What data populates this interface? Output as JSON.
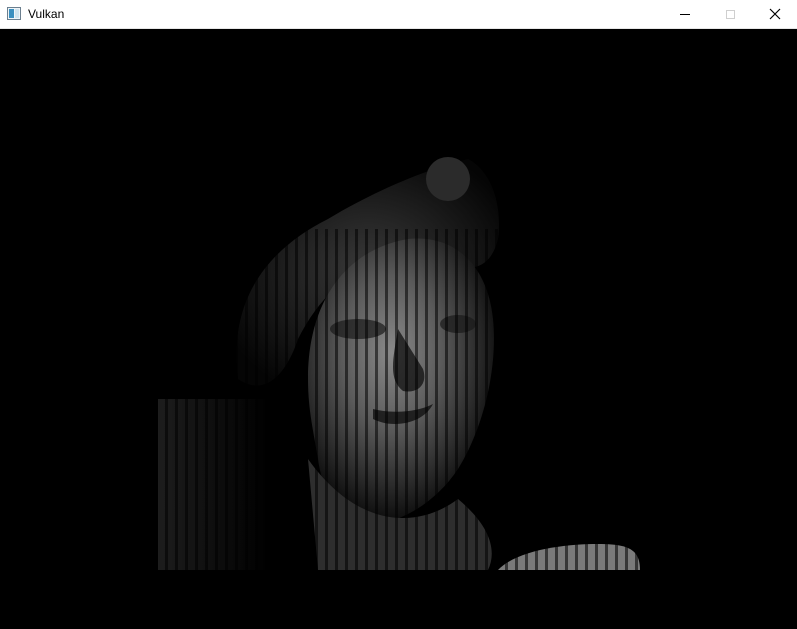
{
  "window": {
    "title": "Vulkan",
    "icon": "vulkan-app-icon",
    "controls": {
      "minimize_icon": "minimize-icon",
      "maximize_icon": "maximize-icon",
      "close_icon": "close-icon"
    }
  },
  "viewport": {
    "background": "#000000",
    "content": "rendered-statue-bust",
    "effect": "vertical-stripe-lighting"
  }
}
